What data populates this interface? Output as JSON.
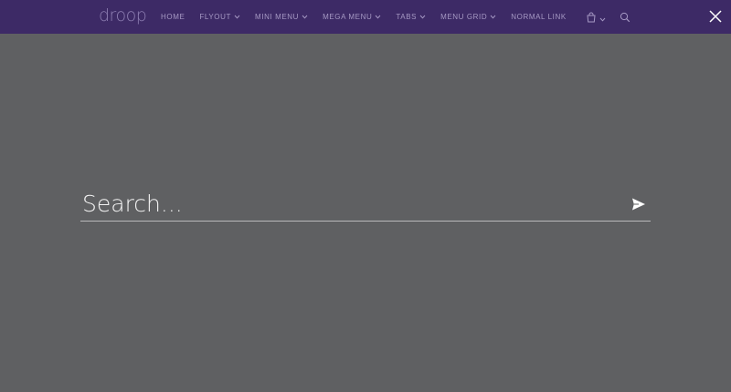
{
  "navbar": {
    "logo": "droop",
    "menu": [
      {
        "label": "HOME",
        "has_dropdown": false
      },
      {
        "label": "FLYOUT",
        "has_dropdown": true
      },
      {
        "label": "MINI MENU",
        "has_dropdown": true
      },
      {
        "label": "MEGA MENU",
        "has_dropdown": true
      },
      {
        "label": "TABS",
        "has_dropdown": true
      },
      {
        "label": "MENU GRID",
        "has_dropdown": true
      },
      {
        "label": "NORMAL LINK",
        "has_dropdown": false
      }
    ],
    "cart_icon": "shopping-bag-icon",
    "search_icon": "search-icon"
  },
  "overlay": {
    "close_icon": "close-icon",
    "search_placeholder": "Search...",
    "search_value": "",
    "submit_icon": "send-icon"
  },
  "colors": {
    "navbar_bg": "#3d2a66",
    "overlay_bg": "#5f6062",
    "nav_text": "#a699c4",
    "input_text": "#ffffff"
  }
}
